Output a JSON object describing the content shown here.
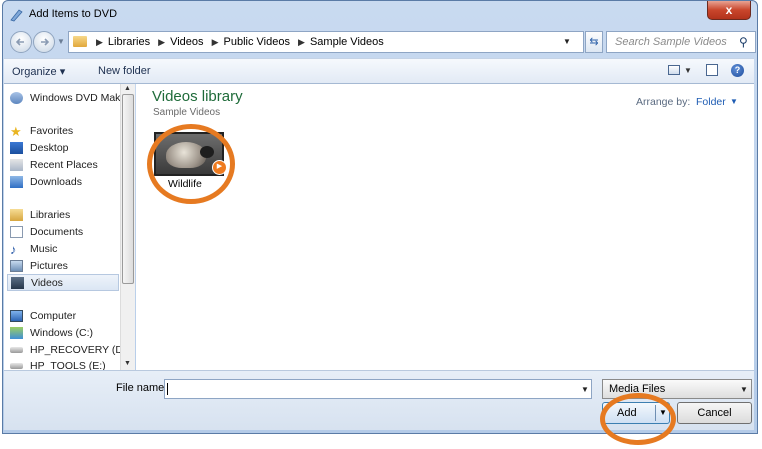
{
  "window": {
    "title": "Add Items to DVD",
    "close_icon": "close-icon",
    "close_label": "x"
  },
  "address": {
    "crumbs": [
      "Libraries",
      "Videos",
      "Public Videos",
      "Sample Videos"
    ],
    "search_placeholder": "Search Sample Videos"
  },
  "toolbar": {
    "organize": "Organize ▾",
    "new_folder": "New folder"
  },
  "nav": {
    "items": [
      {
        "label": "Windows DVD Mak",
        "icon": "dvd-maker-icon"
      },
      {
        "label": "Favorites",
        "icon": "star-icon"
      },
      {
        "label": "Desktop",
        "icon": "desktop-icon"
      },
      {
        "label": "Recent Places",
        "icon": "recent-places-icon"
      },
      {
        "label": "Downloads",
        "icon": "downloads-icon"
      },
      {
        "label": "Libraries",
        "icon": "libraries-icon"
      },
      {
        "label": "Documents",
        "icon": "documents-icon"
      },
      {
        "label": "Music",
        "icon": "music-icon"
      },
      {
        "label": "Pictures",
        "icon": "pictures-icon"
      },
      {
        "label": "Videos",
        "icon": "videos-icon",
        "selected": true
      },
      {
        "label": "Computer",
        "icon": "computer-icon"
      },
      {
        "label": "Windows (C:)",
        "icon": "drive-icon"
      },
      {
        "label": "HP_RECOVERY (D",
        "icon": "drive-icon"
      },
      {
        "label": "HP_TOOLS (E:)",
        "icon": "drive-icon"
      }
    ]
  },
  "content": {
    "title": "Videos library",
    "subtitle": "Sample Videos",
    "arrange_label": "Arrange by:",
    "arrange_value": "Folder",
    "files": [
      {
        "name": "Wildlife",
        "icon": "video-file-icon"
      }
    ]
  },
  "bottom": {
    "file_name_label": "File name:",
    "file_name_value": "",
    "filter_value": "Media Files",
    "add_label": "Add",
    "cancel_label": "Cancel"
  },
  "colors": {
    "annotation_ring": "#e67a21",
    "library_title": "#1e6b39",
    "link": "#1e5cb3"
  }
}
